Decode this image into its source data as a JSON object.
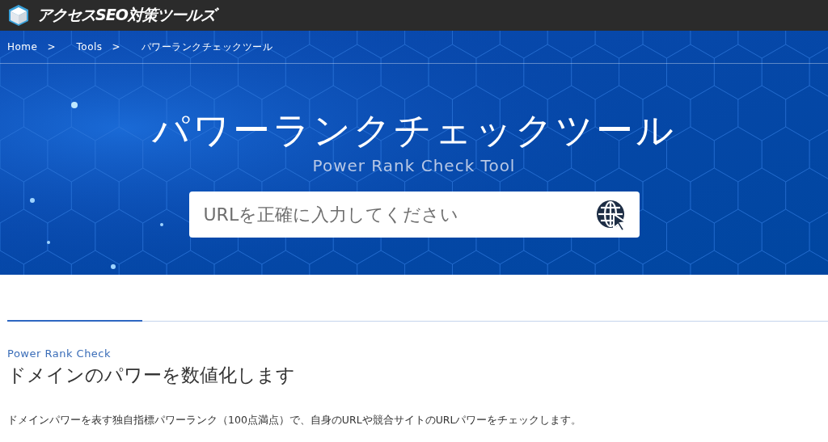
{
  "header": {
    "logo_text": "アクセスSEO対策ツールズ"
  },
  "breadcrumb": [
    {
      "label": "Home",
      "separator": ">"
    },
    {
      "label": "Tools",
      "separator": ">"
    },
    {
      "label": "パワーランクチェックツール"
    }
  ],
  "hero": {
    "title": "パワーランクチェックツール",
    "subtitle": "Power Rank Check Tool",
    "search": {
      "placeholder": "URLを正確に入力してください"
    }
  },
  "section": {
    "eyebrow": "Power Rank Check",
    "heading": "ドメインのパワーを数値化します",
    "body": "ドメインパワーを表す独自指標パワーランク（100点満点）で、自身のURLや競合サイトのURLパワーをチェックします。"
  }
}
